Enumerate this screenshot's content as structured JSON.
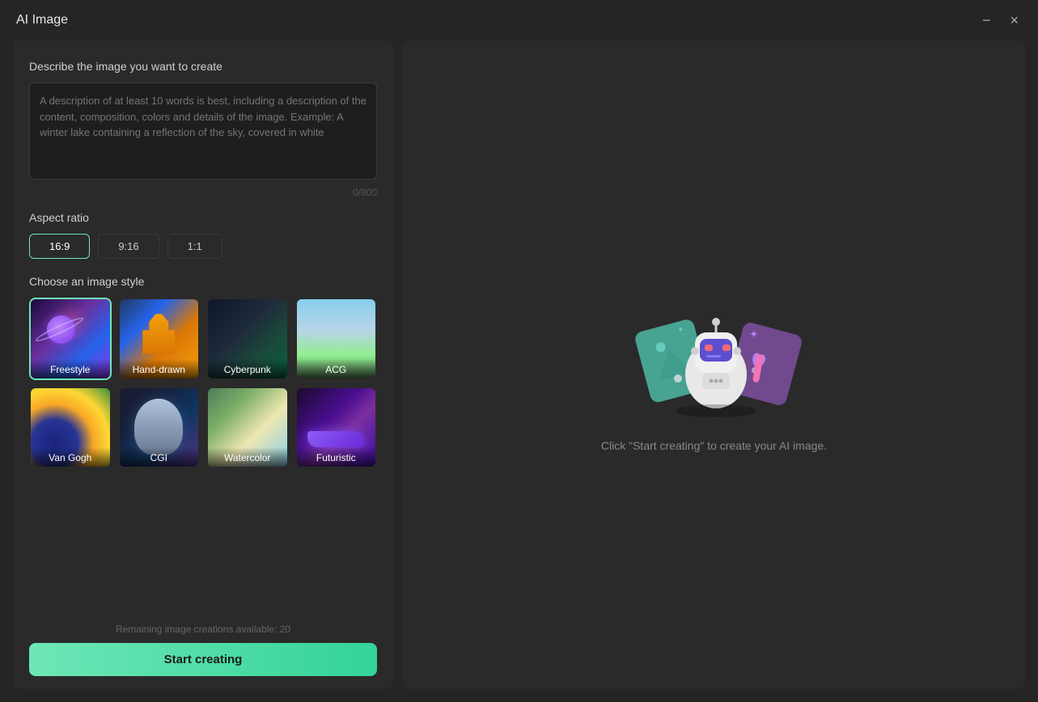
{
  "window": {
    "title": "AI Image"
  },
  "titleBar": {
    "minimizeLabel": "−",
    "closeLabel": "×"
  },
  "leftPanel": {
    "descriptionTitle": "Describe the image you want to create",
    "descriptionPlaceholder": "A description of at least 10 words is best, including a description of the content, composition, colors and details of the image. Example: A winter lake containing a reflection of the sky, covered in white",
    "charCount": "0/800",
    "aspectRatioTitle": "Aspect ratio",
    "aspectRatios": [
      {
        "label": "16:9",
        "value": "16:9",
        "active": true
      },
      {
        "label": "9:16",
        "value": "9:16",
        "active": false
      },
      {
        "label": "1:1",
        "value": "1:1",
        "active": false
      }
    ],
    "stylesTitle": "Choose an image style",
    "styles": [
      {
        "id": "freestyle",
        "label": "Freestyle",
        "selected": true
      },
      {
        "id": "handdrawn",
        "label": "Hand-drawn",
        "selected": false
      },
      {
        "id": "cyberpunk",
        "label": "Cyberpunk",
        "selected": false
      },
      {
        "id": "acg",
        "label": "ACG",
        "selected": false
      },
      {
        "id": "vangogh",
        "label": "Van Gogh",
        "selected": false
      },
      {
        "id": "cgi",
        "label": "CGI",
        "selected": false
      },
      {
        "id": "watercolor",
        "label": "Watercolor",
        "selected": false
      },
      {
        "id": "futuristic",
        "label": "Futuristic",
        "selected": false
      }
    ],
    "remainingText": "Remaining image creations available: 20",
    "startButtonLabel": "Start creating"
  },
  "rightPanel": {
    "promptText": "Click \"Start creating\" to create your AI image."
  }
}
